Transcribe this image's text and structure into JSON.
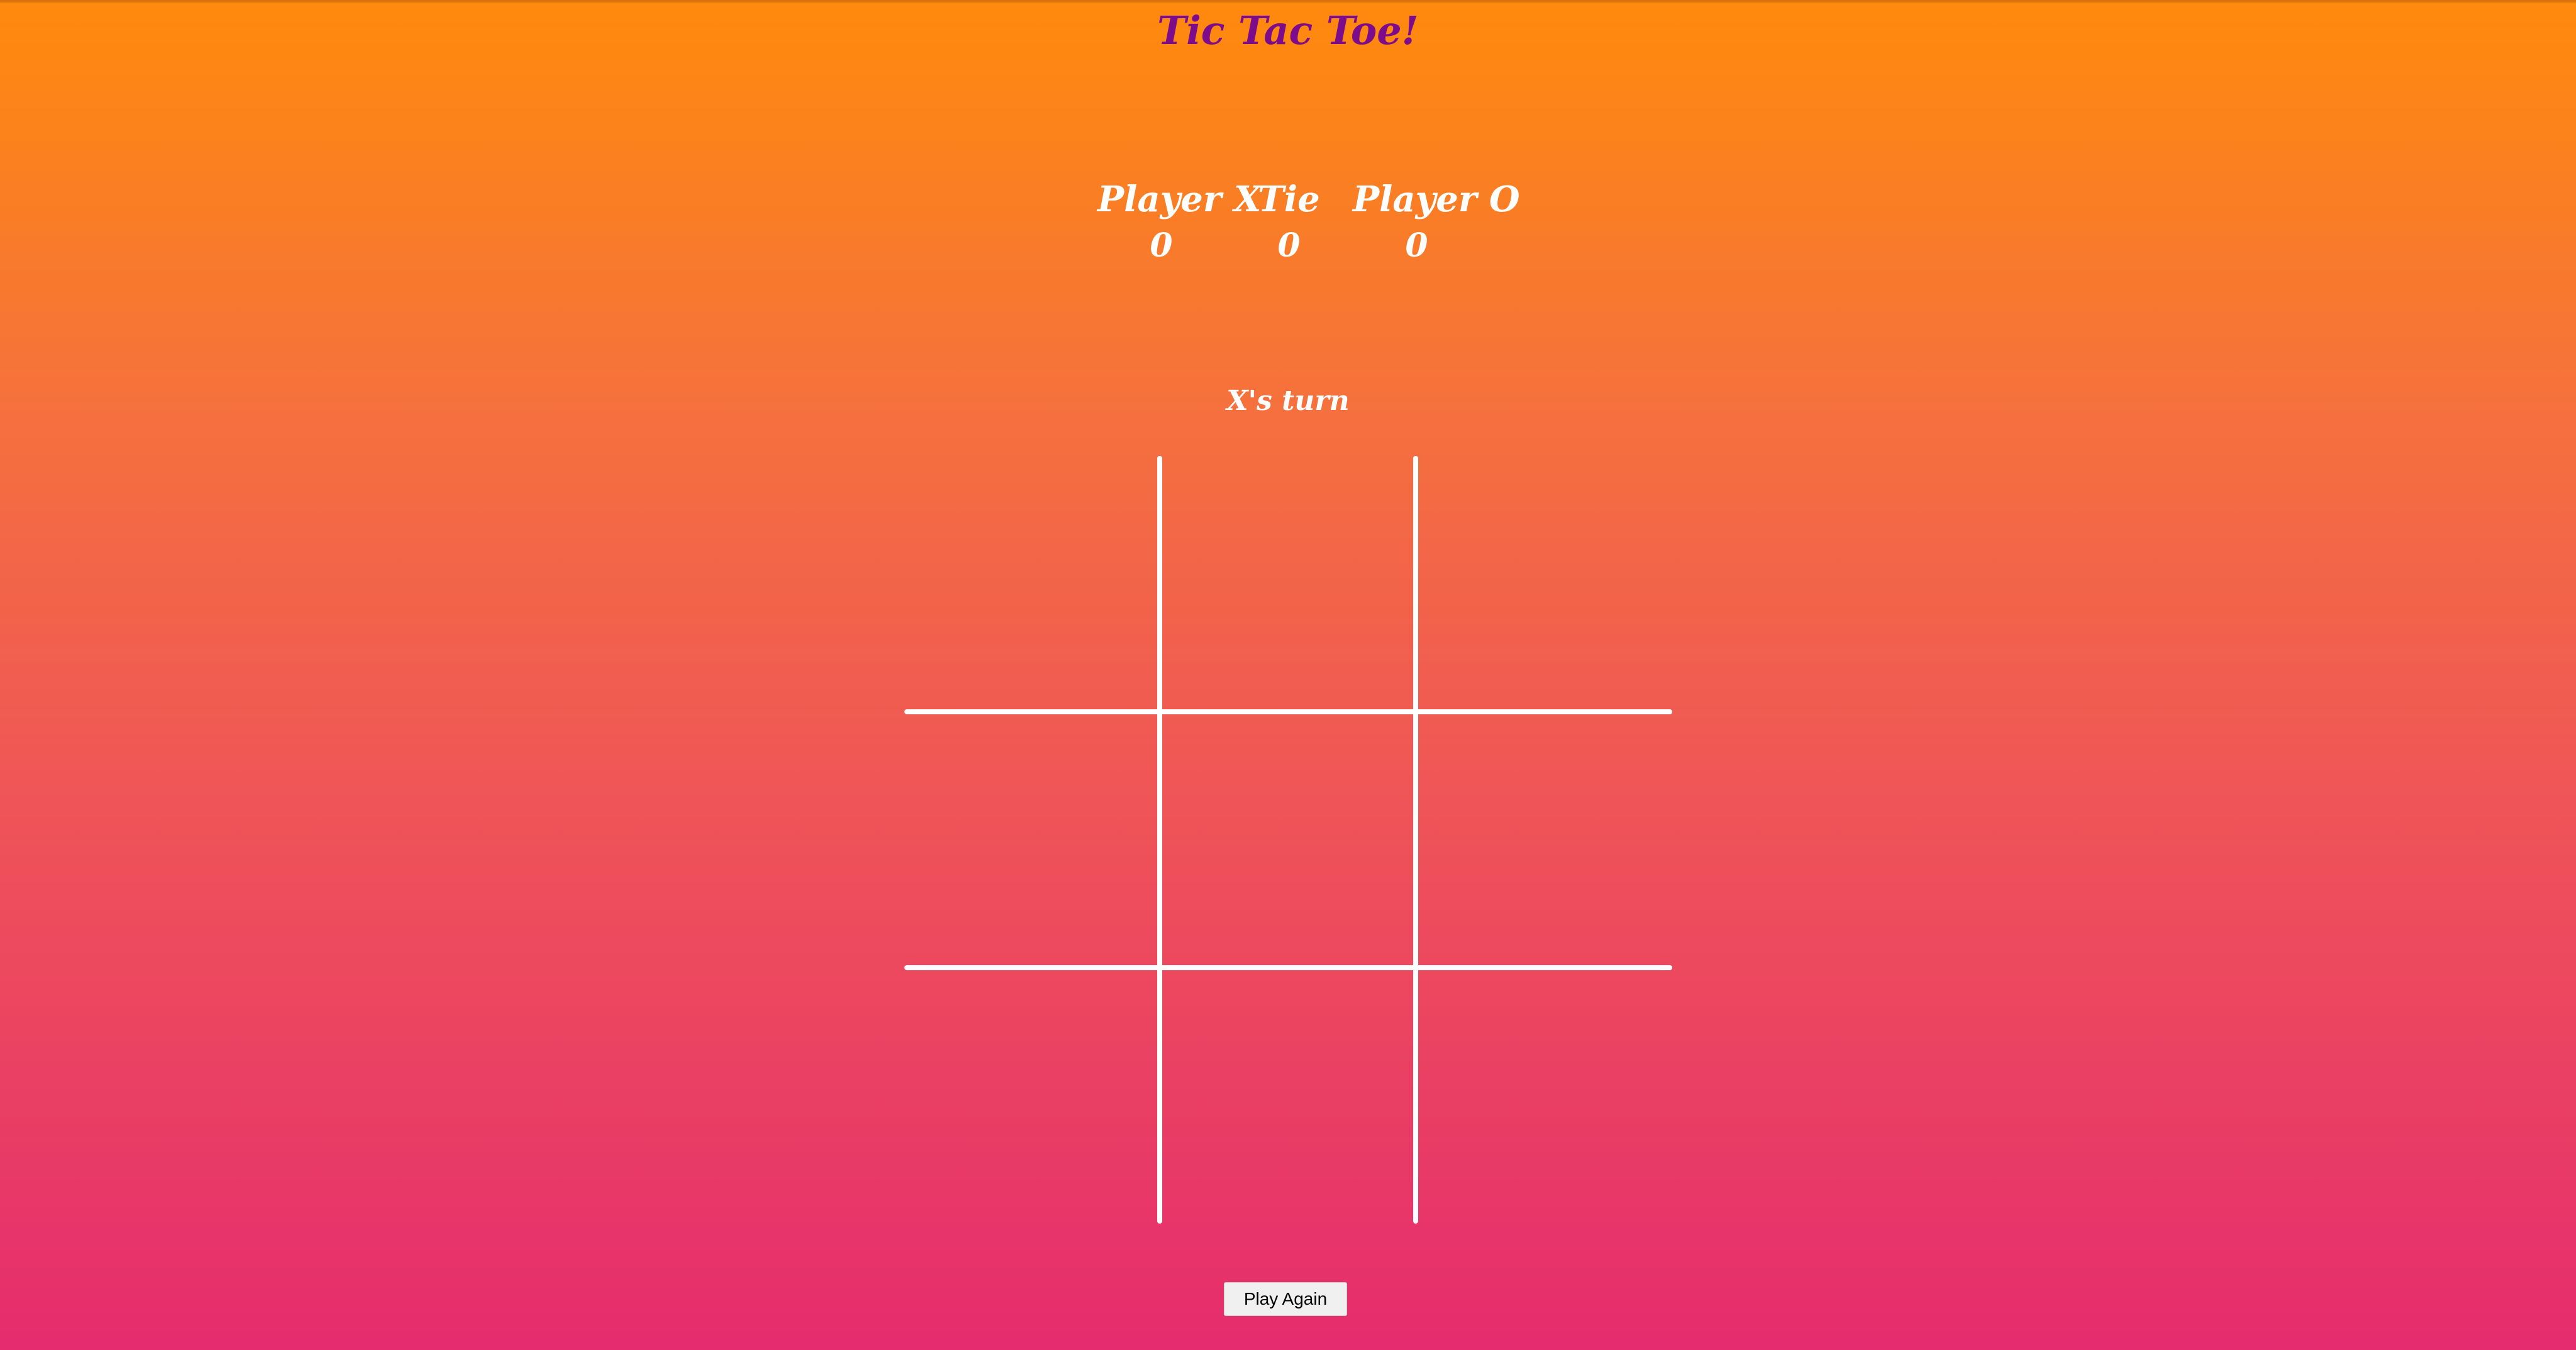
{
  "title": "Tic Tac Toe!",
  "scoreboard": [
    {
      "label": "Player X",
      "value": "0"
    },
    {
      "label": "Tie",
      "value": "0"
    },
    {
      "label": "Player O",
      "value": "0"
    }
  ],
  "status": "X's turn",
  "board": [
    "",
    "",
    "",
    "",
    "",
    "",
    "",
    "",
    ""
  ],
  "play_again_label": "Play Again",
  "colors": {
    "title": "#7d0c8c",
    "gradient_top": "#ff8a0c",
    "gradient_bottom": "#e52c6e",
    "grid": "#ffffff"
  }
}
